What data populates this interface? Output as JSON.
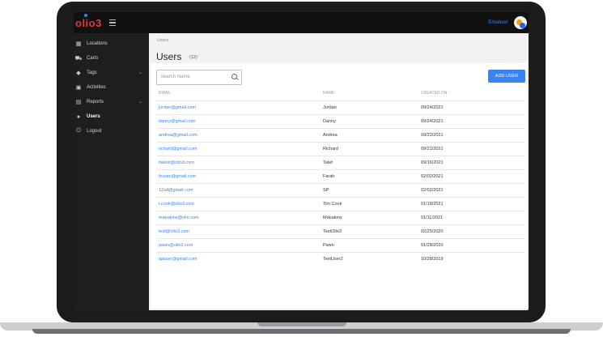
{
  "app": {
    "logo_text": "olio3",
    "user_name": "Emanuel"
  },
  "sidebar": {
    "items": [
      {
        "label": "Locations",
        "icon": "building-icon",
        "chevron": false
      },
      {
        "label": "Carts",
        "icon": "cart-icon",
        "chevron": false
      },
      {
        "label": "Tags",
        "icon": "tag-icon",
        "chevron": true
      },
      {
        "label": "Activities",
        "icon": "calendar-icon",
        "chevron": false
      },
      {
        "label": "Reports",
        "icon": "report-icon",
        "chevron": true
      },
      {
        "label": "Users",
        "icon": "users-icon",
        "chevron": false,
        "active": true
      },
      {
        "label": "Logout",
        "icon": "power-icon",
        "chevron": false
      }
    ]
  },
  "breadcrumb": "Users",
  "page": {
    "title": "Users",
    "count": "(12)"
  },
  "search": {
    "placeholder": "Search Name"
  },
  "add_button": {
    "label": "ADD USER"
  },
  "table": {
    "headers": {
      "email": "EMAIL",
      "name": "NAME",
      "created": "CREATED ON ↑"
    },
    "rows": [
      {
        "email": "jordan@gmail.com",
        "name": "Jordan",
        "created": "09/24/2021"
      },
      {
        "email": "danny@gmail.com",
        "name": "Danny",
        "created": "09/24/2021"
      },
      {
        "email": "andrea@gmail.com",
        "name": "Andrea",
        "created": "09/22/2021"
      },
      {
        "email": "richard@gmail.com",
        "name": "Richard",
        "created": "09/21/2021"
      },
      {
        "email": "itatest@olio3.com",
        "name": "Tatet",
        "created": "09/16/2021"
      },
      {
        "email": "fouran@gmail.com",
        "name": "Farah",
        "created": "02/02/2021"
      },
      {
        "email": "12sd@gmail.com",
        "name": "SP",
        "created": "02/02/2021"
      },
      {
        "email": "t.cook@olio3.com",
        "name": "Tim Cook",
        "created": "01/18/2021"
      },
      {
        "email": "mdeakins@olio.com",
        "name": "Mdeakins",
        "created": "01/11/2021"
      },
      {
        "email": "test@olio3.com",
        "name": "TestOlio3",
        "created": "02/25/2020"
      },
      {
        "email": "pawn@olio3.com",
        "name": "Pawn",
        "created": "01/28/2020"
      },
      {
        "email": "qauser@gmail.com",
        "name": "TestUser2",
        "created": "10/28/2019"
      }
    ]
  },
  "colors": {
    "accent": "#3b82f6",
    "logo": "#e23b3b",
    "sidebar": "#1e1e1e"
  }
}
